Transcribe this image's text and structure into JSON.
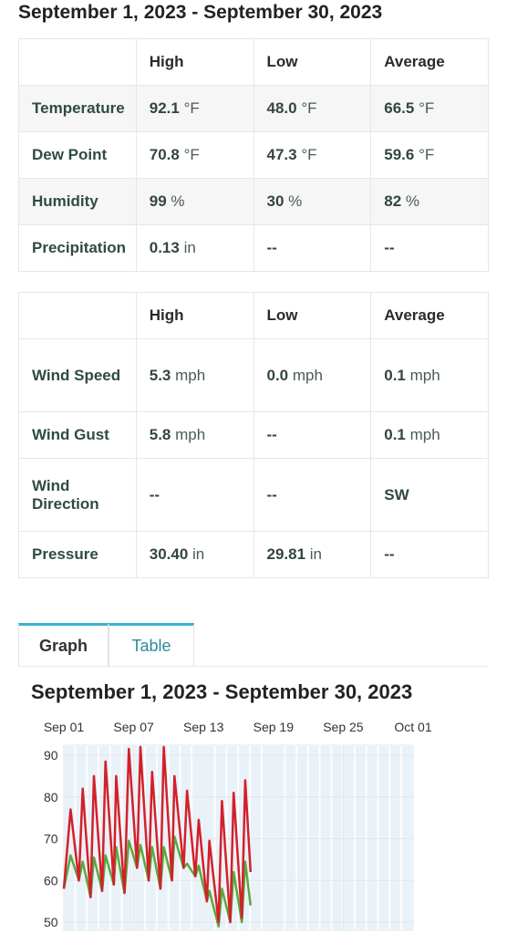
{
  "title": "September 1, 2023 - September 30, 2023",
  "table1": {
    "headers": [
      "",
      "High",
      "Low",
      "Average"
    ],
    "rows": [
      {
        "label": "Temperature",
        "high": "92.1",
        "high_unit": "°F",
        "low": "48.0",
        "low_unit": "°F",
        "avg": "66.5",
        "avg_unit": "°F"
      },
      {
        "label": "Dew Point",
        "high": "70.8",
        "high_unit": "°F",
        "low": "47.3",
        "low_unit": "°F",
        "avg": "59.6",
        "avg_unit": "°F"
      },
      {
        "label": "Humidity",
        "high": "99",
        "high_unit": "%",
        "low": "30",
        "low_unit": "%",
        "avg": "82",
        "avg_unit": "%"
      },
      {
        "label": "Precipitation",
        "high": "0.13",
        "high_unit": "in",
        "low": "--",
        "low_unit": "",
        "avg": "--",
        "avg_unit": ""
      }
    ]
  },
  "table2": {
    "headers": [
      "",
      "High",
      "Low",
      "Average"
    ],
    "rows": [
      {
        "label": "Wind Speed",
        "high": "5.3",
        "high_unit": "mph",
        "low": "0.0",
        "low_unit": "mph",
        "avg": "0.1",
        "avg_unit": "mph"
      },
      {
        "label": "Wind Gust",
        "high": "5.8",
        "high_unit": "mph",
        "low": "--",
        "low_unit": "",
        "avg": "0.1",
        "avg_unit": "mph"
      },
      {
        "label": "Wind Direction",
        "high": "--",
        "high_unit": "",
        "low": "--",
        "low_unit": "",
        "avg": "SW",
        "avg_unit": ""
      },
      {
        "label": "Pressure",
        "high": "30.40",
        "high_unit": "in",
        "low": "29.81",
        "low_unit": "in",
        "avg": "--",
        "avg_unit": ""
      }
    ]
  },
  "tabs": {
    "graph": "Graph",
    "table": "Table",
    "active": "graph",
    "accent": "#3bb0cc"
  },
  "chart_title": "September 1, 2023 - September 30, 2023",
  "chart_data": {
    "type": "line",
    "x_ticks": [
      "Sep 01",
      "Sep 07",
      "Sep 13",
      "Sep 19",
      "Sep 25",
      "Oct 01"
    ],
    "x_range": [
      "2023-09-01",
      "2023-10-01"
    ],
    "y_ticks": [
      50,
      60,
      70,
      80,
      90
    ],
    "ylim": [
      48,
      92.5
    ],
    "grid": true,
    "series": [
      {
        "color": "#d4202a",
        "points": [
          [
            "2023-09-01T00:00",
            58
          ],
          [
            "2023-09-01T14:00",
            77
          ],
          [
            "2023-09-02T07:00",
            60
          ],
          [
            "2023-09-02T15:00",
            82
          ],
          [
            "2023-09-03T07:00",
            56
          ],
          [
            "2023-09-03T14:00",
            85
          ],
          [
            "2023-09-04T07:00",
            57.5
          ],
          [
            "2023-09-04T14:00",
            88.5
          ],
          [
            "2023-09-05T07:00",
            59
          ],
          [
            "2023-09-05T12:00",
            85
          ],
          [
            "2023-09-06T05:00",
            57
          ],
          [
            "2023-09-06T14:00",
            91.5
          ],
          [
            "2023-09-07T07:00",
            63
          ],
          [
            "2023-09-07T14:00",
            92
          ],
          [
            "2023-09-08T07:00",
            60
          ],
          [
            "2023-09-08T14:00",
            86
          ],
          [
            "2023-09-09T07:00",
            58
          ],
          [
            "2023-09-09T14:00",
            92
          ],
          [
            "2023-09-10T07:00",
            60
          ],
          [
            "2023-09-10T12:00",
            85
          ],
          [
            "2023-09-11T07:00",
            63
          ],
          [
            "2023-09-11T14:00",
            81.5
          ],
          [
            "2023-09-12T07:00",
            61
          ],
          [
            "2023-09-12T14:00",
            74.5
          ],
          [
            "2023-09-13T07:00",
            55
          ],
          [
            "2023-09-13T12:00",
            69.5
          ],
          [
            "2023-09-14T07:00",
            50
          ],
          [
            "2023-09-14T14:00",
            79
          ],
          [
            "2023-09-15T07:00",
            50
          ],
          [
            "2023-09-15T14:00",
            81
          ],
          [
            "2023-09-16T07:00",
            51
          ],
          [
            "2023-09-16T14:00",
            84
          ],
          [
            "2023-09-17T01:00",
            62
          ]
        ]
      },
      {
        "color": "#5aa83e",
        "points": [
          [
            "2023-09-01T00:00",
            58
          ],
          [
            "2023-09-01T14:00",
            66
          ],
          [
            "2023-09-02T07:00",
            60
          ],
          [
            "2023-09-02T15:00",
            64.5
          ],
          [
            "2023-09-03T07:00",
            56
          ],
          [
            "2023-09-03T14:00",
            65.5
          ],
          [
            "2023-09-04T07:00",
            57.5
          ],
          [
            "2023-09-04T14:00",
            66
          ],
          [
            "2023-09-05T07:00",
            59
          ],
          [
            "2023-09-05T12:00",
            68
          ],
          [
            "2023-09-06T05:00",
            57
          ],
          [
            "2023-09-06T14:00",
            69.5
          ],
          [
            "2023-09-07T07:00",
            63
          ],
          [
            "2023-09-07T14:00",
            68.5
          ],
          [
            "2023-09-08T07:00",
            60
          ],
          [
            "2023-09-08T14:00",
            68
          ],
          [
            "2023-09-09T07:00",
            58
          ],
          [
            "2023-09-09T14:00",
            68
          ],
          [
            "2023-09-10T07:00",
            60
          ],
          [
            "2023-09-10T12:00",
            70.5
          ],
          [
            "2023-09-11T07:00",
            63
          ],
          [
            "2023-09-11T14:00",
            64
          ],
          [
            "2023-09-12T07:00",
            61
          ],
          [
            "2023-09-12T14:00",
            63.5
          ],
          [
            "2023-09-13T07:00",
            55
          ],
          [
            "2023-09-13T12:00",
            57.5
          ],
          [
            "2023-09-14T07:00",
            49
          ],
          [
            "2023-09-14T14:00",
            58
          ],
          [
            "2023-09-15T07:00",
            50
          ],
          [
            "2023-09-15T14:00",
            62
          ],
          [
            "2023-09-16T07:00",
            50
          ],
          [
            "2023-09-16T14:00",
            64.5
          ],
          [
            "2023-09-17T01:00",
            54
          ]
        ]
      }
    ]
  }
}
